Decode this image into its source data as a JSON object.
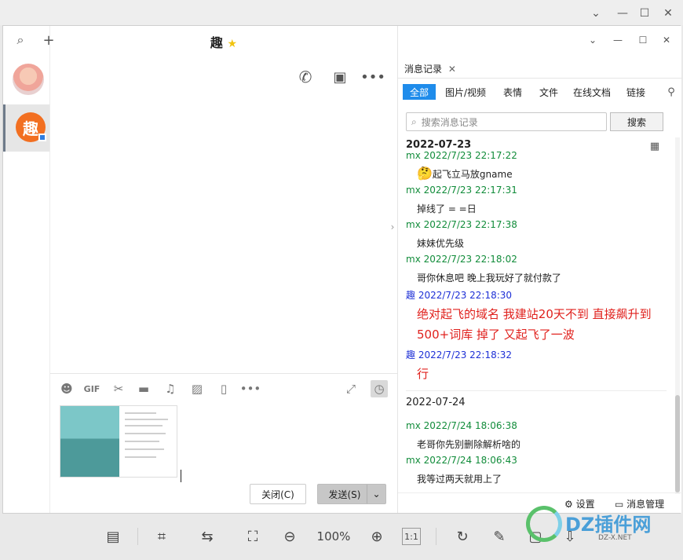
{
  "window": {
    "min_icon": "minimize-icon",
    "max_icon": "maximize-icon",
    "close_icon": "close-icon",
    "restore_icon": "chevron-down-icon"
  },
  "chat": {
    "title": "趣",
    "title_star": "★",
    "input_text": ""
  },
  "compose": {
    "close_label": "关闭(C)",
    "send_label": "发送(S)"
  },
  "history": {
    "tab_label": "消息记录",
    "filters": [
      "全部",
      "图片/视频",
      "表情",
      "文件",
      "在线文档",
      "链接"
    ],
    "search_placeholder": "搜索消息记录",
    "search_button": "搜索",
    "settings_label": "设置",
    "manage_label": "消息管理",
    "messages": [
      {
        "type": "date",
        "text": "2022-07-23"
      },
      {
        "type": "sender",
        "color": "green",
        "text": "mx 2022/7/23 22:17:22"
      },
      {
        "type": "text",
        "text": "起飞立马放gname",
        "emoji": "🤔"
      },
      {
        "type": "sender",
        "color": "green",
        "text": "mx 2022/7/23 22:17:31"
      },
      {
        "type": "text",
        "text": "掉线了 = =日"
      },
      {
        "type": "sender",
        "color": "green",
        "text": "mx 2022/7/23 22:17:38"
      },
      {
        "type": "text",
        "text": "妹妹优先级"
      },
      {
        "type": "sender",
        "color": "green",
        "text": "mx 2022/7/23 22:18:02"
      },
      {
        "type": "text",
        "text": "哥你休息吧 晚上我玩好了就付款了"
      },
      {
        "type": "sender",
        "color": "blue",
        "text": "趣 2022/7/23 22:18:30"
      },
      {
        "type": "red",
        "text": "绝对起飞的域名  我建站20天不到  直接飙升到"
      },
      {
        "type": "red",
        "text": "500+词库  掉了 又起飞了一波"
      },
      {
        "type": "sender",
        "color": "blue",
        "text": "趣 2022/7/23 22:18:32"
      },
      {
        "type": "red",
        "text": "行"
      },
      {
        "type": "date",
        "text": "2022-07-24"
      },
      {
        "type": "sender",
        "color": "green",
        "text": "mx 2022/7/24 18:06:38"
      },
      {
        "type": "text",
        "text": "老哥你先别删除解析啥的"
      },
      {
        "type": "sender",
        "color": "green",
        "text": "mx 2022/7/24 18:06:43"
      },
      {
        "type": "text",
        "text": "我等过两天就用上了"
      }
    ]
  },
  "viewer": {
    "zoom": "100%",
    "ratio_label": "1:1"
  },
  "watermark": {
    "brand": "DZ插件网",
    "url": "DZ-X.NET"
  }
}
